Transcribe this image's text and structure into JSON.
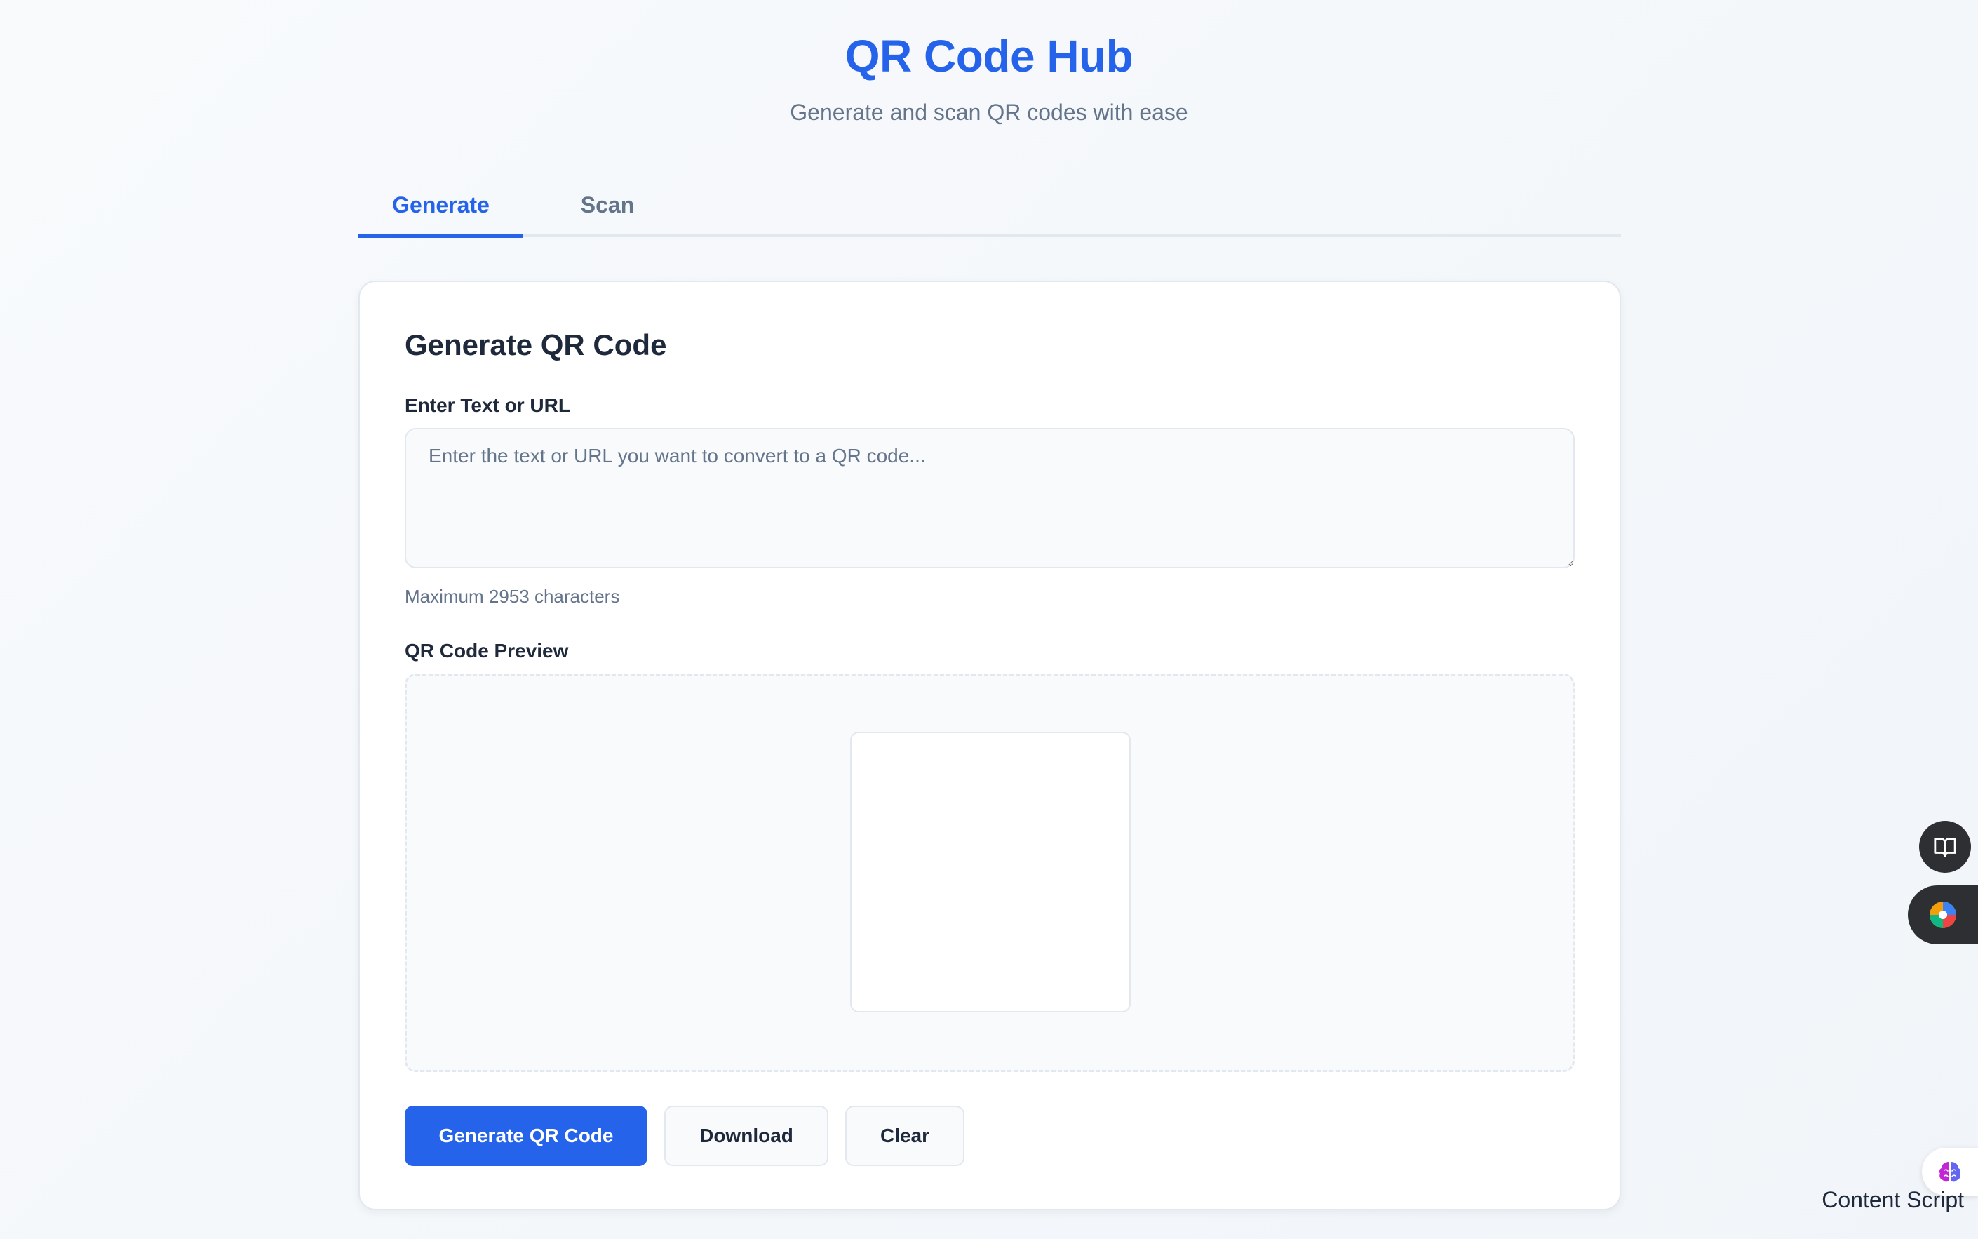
{
  "header": {
    "title": "QR Code Hub",
    "subtitle": "Generate and scan QR codes with ease"
  },
  "tabs": [
    {
      "label": "Generate",
      "active": true
    },
    {
      "label": "Scan",
      "active": false
    }
  ],
  "generate": {
    "card_title": "Generate QR Code",
    "input_label": "Enter Text or URL",
    "input_value": "",
    "input_placeholder": "Enter the text or URL you want to convert to a QR code...",
    "helper_text": "Maximum 2953 characters",
    "preview_label": "QR Code Preview",
    "buttons": {
      "generate": "Generate QR Code",
      "download": "Download",
      "clear": "Clear"
    }
  },
  "overlay": {
    "content_script_label": "Content Script",
    "icons": [
      "book-open-icon",
      "colorful-ai-icon",
      "brain-icon"
    ]
  },
  "colors": {
    "primary": "#2563eb",
    "text": "#1e293b",
    "muted": "#64748b",
    "border": "#e2e8f0",
    "surface": "#f8fafc"
  }
}
